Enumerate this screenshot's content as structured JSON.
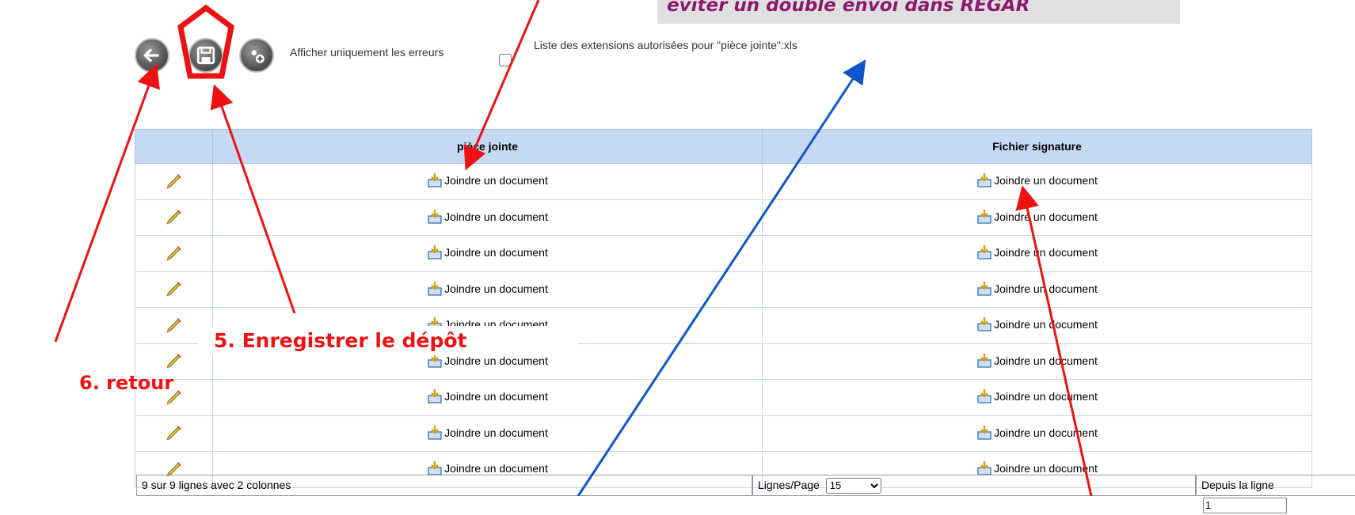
{
  "banner": {
    "text": "éviter un double envoi dans REGAR"
  },
  "toolbar": {
    "back_icon": "arrow-left-icon",
    "save_icon": "floppy-disk-icon",
    "add_icon": "add-icon",
    "filter_label": "Afficher uniquement les erreurs",
    "extensions_info": "Liste des extensions autorisées pour \"pièce jointe\":xls"
  },
  "table": {
    "columns": [
      "",
      "pièce jointe",
      "Fichier signature"
    ],
    "rows": [
      {
        "piece_jointe": "Joindre un document",
        "fichier_signature": "Joindre un document"
      },
      {
        "piece_jointe": "Joindre un document",
        "fichier_signature": "Joindre un document"
      },
      {
        "piece_jointe": "Joindre un document",
        "fichier_signature": "Joindre un document"
      },
      {
        "piece_jointe": "Joindre un document",
        "fichier_signature": "Joindre un document"
      },
      {
        "piece_jointe": "Joindre un document",
        "fichier_signature": "Joindre un document"
      },
      {
        "piece_jointe": "Joindre un document",
        "fichier_signature": "Joindre un document"
      },
      {
        "piece_jointe": "Joindre un document",
        "fichier_signature": "Joindre un document"
      },
      {
        "piece_jointe": "Joindre un document",
        "fichier_signature": "Joindre un document"
      },
      {
        "piece_jointe": "Joindre un document",
        "fichier_signature": "Joindre un document"
      }
    ]
  },
  "footer": {
    "summary": "9 sur 9 lignes avec 2 colonnes",
    "lines_per_page_label": "Lignes/Page",
    "lines_per_page_value": "15",
    "from_line_label": "Depuis la ligne",
    "from_line_value": "1"
  },
  "annotations": {
    "save": "5. Enregistrer le dépôt",
    "back": "6. retour",
    "red_color": "#ee1111",
    "blue_color": "#1155cc"
  }
}
